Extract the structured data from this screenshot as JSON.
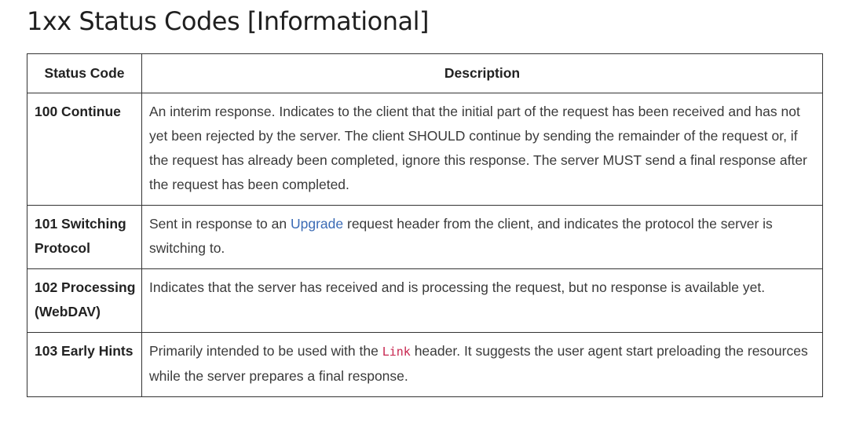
{
  "heading": "1xx Status Codes [Informational]",
  "table": {
    "headers": {
      "code": "Status Code",
      "description": "Description"
    },
    "rows": [
      {
        "code": "100 Continue",
        "description": "An interim response. Indicates to the client that the initial part of the request has been received and has not yet been rejected by the server. The client SHOULD continue by sending the remainder of the request or, if the request has already been completed, ignore this response. The server MUST send a final response after the request has been completed."
      },
      {
        "code": "101 Switching Protocol",
        "desc_before": "Sent in response to an ",
        "desc_link": "Upgrade",
        "desc_after": " request header from the client, and indicates the protocol the server is switching to."
      },
      {
        "code": "102 Processing (WebDAV)",
        "description": "Indicates that the server has received and is processing the request, but no response is available yet."
      },
      {
        "code": "103 Early Hints",
        "desc_before": "Primarily intended to be used with the ",
        "desc_code": "Link",
        "desc_after": " header. It suggests the user agent start preloading the resources while the server prepares a final response."
      }
    ]
  },
  "colors": {
    "link": "#3b6bb5",
    "inline_code": "#c7254e",
    "border": "#333333"
  }
}
